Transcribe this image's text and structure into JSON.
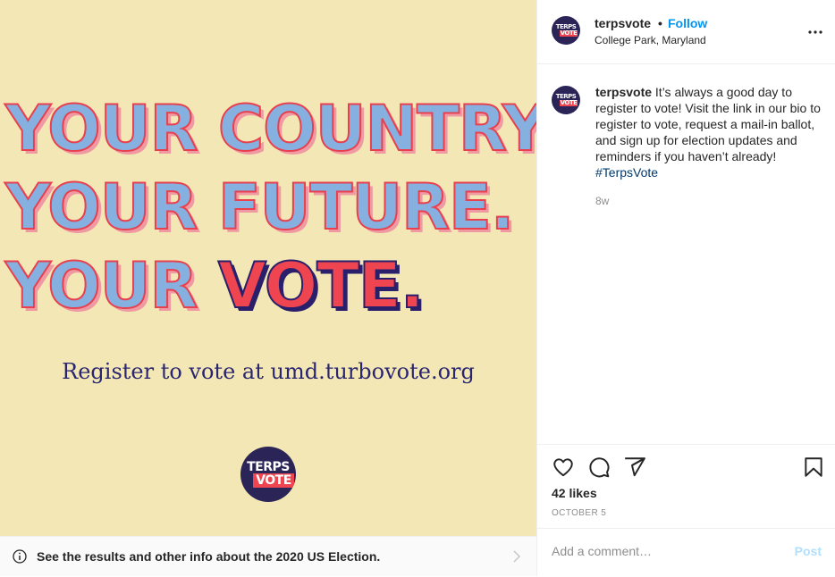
{
  "post_image": {
    "headline": [
      "YOUR COUNTRY.",
      "YOUR FUTURE.",
      "YOUR "
    ],
    "headline_highlight": "VOTE.",
    "register_text": "Register to vote at umd.turbovote.org",
    "logo": {
      "line1": "TERPS",
      "line2": "VOTE"
    },
    "colors": {
      "background": "#f3e8b5",
      "blue_letters": "#85b0df",
      "red": "#ee4551",
      "navy": "#2a1f6b"
    }
  },
  "election_banner": {
    "text": "See the results and other info about the 2020 US Election.",
    "icon": "info-icon"
  },
  "header": {
    "username": "terpsvote",
    "separator": "•",
    "follow_label": "Follow",
    "location": "College Park, Maryland",
    "avatar": {
      "line1": "TERPS",
      "line2": "VOTE"
    }
  },
  "caption": {
    "username": "terpsvote",
    "text": "It’s always a good day to register to vote! Visit the link in our bio to register to vote, request a mail-in ballot, and sign up for election updates and reminders if you haven’t already!",
    "hashtag": "#TerpsVote",
    "age": "8w"
  },
  "actions": {
    "likes": "42 likes",
    "date": "OCTOBER 5",
    "icons": [
      "heart-icon",
      "comment-icon",
      "share-icon",
      "bookmark-icon"
    ]
  },
  "comment": {
    "placeholder": "Add a comment…",
    "post_label": "Post"
  }
}
